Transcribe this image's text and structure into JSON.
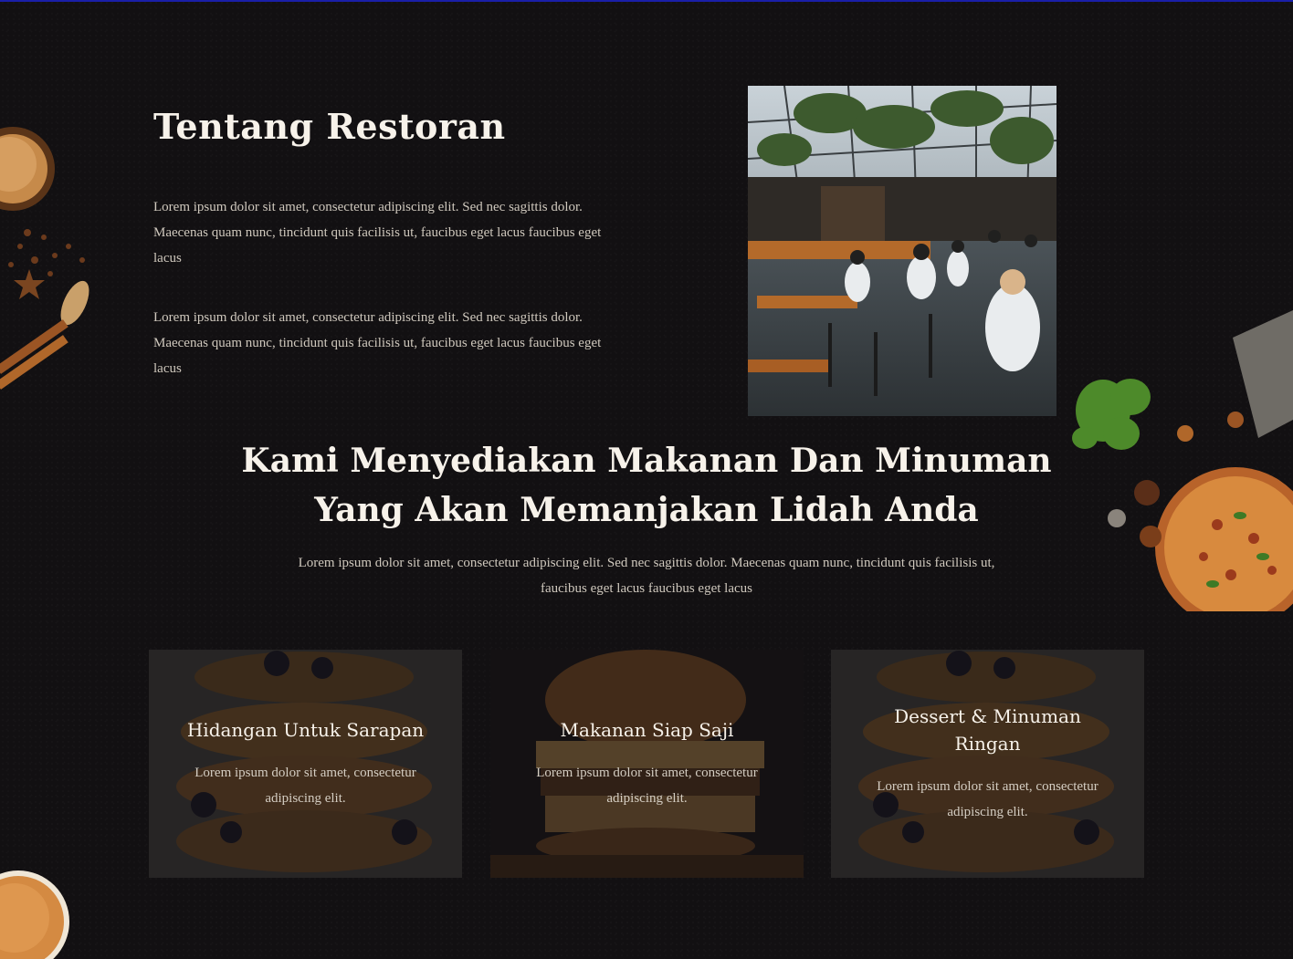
{
  "about": {
    "title": "Tentang Restoran",
    "paragraph1": "Lorem ipsum dolor sit amet, consectetur adipiscing elit. Sed nec sagittis dolor. Maecenas quam nunc, tincidunt quis facilisis ut, faucibus eget lacus faucibus eget lacus",
    "paragraph2": "Lorem ipsum dolor sit amet, consectetur adipiscing elit. Sed nec sagittis dolor. Maecenas quam nunc, tincidunt quis facilisis ut, faucibus eget lacus faucibus eget lacus"
  },
  "intro": {
    "heading": "Kami Menyediakan Makanan Dan Minuman Yang Akan Memanjakan Lidah Anda",
    "description": "Lorem ipsum dolor sit amet, consectetur adipiscing elit. Sed nec sagittis dolor. Maecenas quam nunc, tincidunt quis facilisis ut, faucibus eget lacus faucibus eget lacus"
  },
  "cards": [
    {
      "title": "Hidangan Untuk Sarapan",
      "description": "Lorem ipsum dolor sit amet, consectetur adipiscing elit."
    },
    {
      "title": "Makanan Siap Saji",
      "description": "Lorem ipsum dolor sit amet, consectetur adipiscing elit."
    },
    {
      "title": "Dessert & Minuman Ringan",
      "description": "Lorem ipsum dolor sit amet, consectetur adipiscing elit."
    }
  ],
  "colors": {
    "background": "#121012",
    "heading": "#f7f2ea",
    "body_text": "#cfc8bd",
    "accent_wood": "#b0672a",
    "top_border": "#1a1fa8"
  },
  "images": {
    "restaurant_photo": "restaurant-interior-photo",
    "card_1_bg": "pancake-stack-photo",
    "card_2_bg": "burger-photo",
    "card_3_bg": "pancake-stack-photo",
    "deco_left": "spices-decoration",
    "deco_right": "pizza-herbs-decoration",
    "deco_bottom_left": "flatbread-decoration"
  }
}
